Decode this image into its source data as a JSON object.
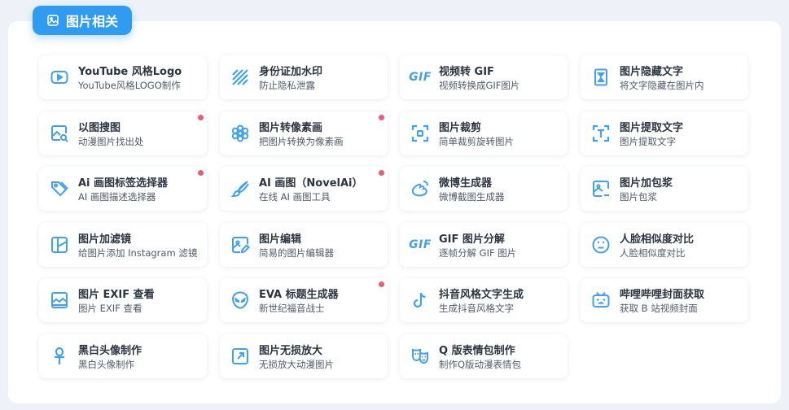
{
  "section": {
    "title": "图片相关",
    "icon": "image-icon"
  },
  "accent_color": "#2f9cf1",
  "badge_color": "#ef5b74",
  "cards": [
    {
      "title": "YouTube 风格Logo",
      "desc": "YouTube风格LOGO制作",
      "icon": "youtube-icon",
      "dot": false
    },
    {
      "title": "身份证加水印",
      "desc": "防止隐私泄露",
      "icon": "stripes-icon",
      "dot": false
    },
    {
      "title": "视频转 GIF",
      "desc": "视频转换成GIF图片",
      "icon": "gif-icon",
      "dot": false
    },
    {
      "title": "图片隐藏文字",
      "desc": "将文字隐藏在图片内",
      "icon": "hourglass-icon",
      "dot": false
    },
    {
      "title": "以图搜图",
      "desc": "动漫图片找出处",
      "icon": "image-search-icon",
      "dot": true
    },
    {
      "title": "图片转像素画",
      "desc": "把图片转换为像素画",
      "icon": "flower-icon",
      "dot": true
    },
    {
      "title": "图片裁剪",
      "desc": "简单裁剪旋转图片",
      "icon": "crop-icon",
      "dot": false
    },
    {
      "title": "图片提取文字",
      "desc": "图片提取文字",
      "icon": "text-scan-icon",
      "dot": false
    },
    {
      "title": "Ai 画图标签选择器",
      "desc": "AI 画图描述选择器",
      "icon": "tags-icon",
      "dot": true
    },
    {
      "title": "AI 画图（NovelAi）",
      "desc": "在线 AI 画图工具",
      "icon": "paintbrush-icon",
      "dot": true
    },
    {
      "title": "微博生成器",
      "desc": "微博截图生成器",
      "icon": "weibo-icon",
      "dot": false
    },
    {
      "title": "图片加包浆",
      "desc": "图片包浆",
      "icon": "image-edit-icon",
      "dot": false
    },
    {
      "title": "图片加滤镜",
      "desc": "给图片添加 Instagram 滤镜",
      "icon": "filter-icon",
      "dot": false
    },
    {
      "title": "图片编辑",
      "desc": "简易的图片编辑器",
      "icon": "image-pencil-icon",
      "dot": false
    },
    {
      "title": "GIF 图片分解",
      "desc": "逐帧分解 GIF 图片",
      "icon": "gif-icon",
      "dot": false
    },
    {
      "title": "人脸相似度对比",
      "desc": "人脸相似度对比",
      "icon": "face-icon",
      "dot": false
    },
    {
      "title": "图片 EXIF 查看",
      "desc": "图片 EXIF 查看",
      "icon": "landscape-icon",
      "dot": false
    },
    {
      "title": "EVA 标题生成器",
      "desc": "新世纪福音战士",
      "icon": "alien-icon",
      "dot": true
    },
    {
      "title": "抖音风格文字生成",
      "desc": "生成抖音风格文字",
      "icon": "tiktok-icon",
      "dot": false
    },
    {
      "title": "哔哩哔哩封面获取",
      "desc": "获取 B 站视频封面",
      "icon": "bilibili-icon",
      "dot": false
    },
    {
      "title": "黑白头像制作",
      "desc": "黑白头像制作",
      "icon": "ankh-icon",
      "dot": false
    },
    {
      "title": "图片无损放大",
      "desc": "无损放大动漫图片",
      "icon": "expand-icon",
      "dot": false
    },
    {
      "title": "Q 版表情包制作",
      "desc": "制作Q版动漫表情包",
      "icon": "masks-icon",
      "dot": false
    }
  ]
}
